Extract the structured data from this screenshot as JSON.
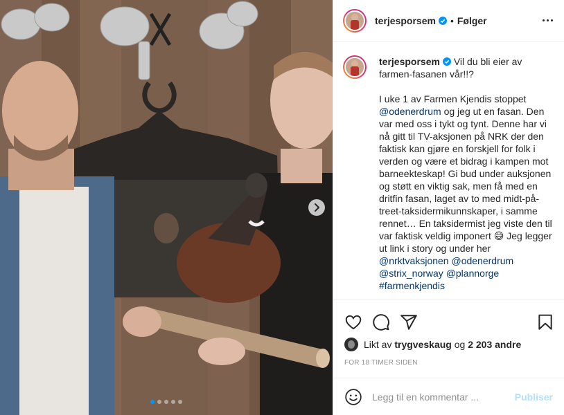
{
  "post": {
    "username": "terjesporsem",
    "follow_label": "Følger",
    "separator": "•",
    "caption": {
      "username": "terjesporsem",
      "first_line": "Vil du bli eier av farmen-fasanen vår!!?",
      "body": {
        "part1": "I uke 1 av Farmen Kjendis stoppet ",
        "mention1": "@odenerdrum",
        "part2": " og jeg ut en fasan. Den var med oss i tykt og tynt. Denne har vi nå gitt til TV-aksjonen på NRK der den faktisk kan gjøre en forskjell for folk i verden og være et bidrag i kampen mot barneekteskap! Gi bud under auksjonen og støtt en viktig sak, men få med en dritfin fasan, laget av to med midt-på-treet-taksidermikunnskaper, i samme rennet… En taksidermist jeg viste den til var faktisk veldig imponert ",
        "emoji": "😅",
        "part3": " Jeg legger ut link i story og under her ",
        "mention2": "@nrktvaksjonen",
        "mention3": "@odenerdrum",
        "mention4": "@strix_norway",
        "mention5": "@plannorge",
        "hashtag": "#farmenkjendis"
      }
    },
    "likes": {
      "prefix": "Likt av",
      "first_user": "trygveskaug",
      "joiner": "og",
      "others": "2 203 andre"
    },
    "timestamp": "FOR 18 TIMER SIDEN",
    "comment": {
      "placeholder": "Legg til en kommentar ...",
      "publish_label": "Publiser"
    },
    "carousel": {
      "total_images": 5,
      "active_index": 0
    }
  },
  "colors": {
    "verified": "#0095f6",
    "mention": "#00376b",
    "publish_disabled": "#b2dffc",
    "muted": "#8e8e8e"
  },
  "icons": [
    "verified-icon",
    "more-options-icon",
    "heart-icon",
    "comment-icon",
    "share-icon",
    "bookmark-icon",
    "emoji-icon",
    "carousel-next-icon"
  ]
}
